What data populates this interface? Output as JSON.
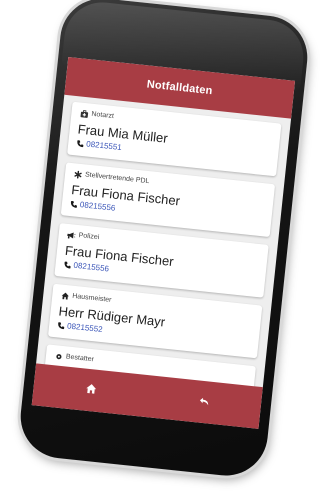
{
  "appbar": {
    "title": "Notfalldaten"
  },
  "contacts": [
    {
      "role": "Notarzt",
      "icon": "medical-case-icon",
      "name": "Frau Mia Müller",
      "phone": "08215551"
    },
    {
      "role": "Stellvertretende PDL",
      "icon": "asterisk-icon",
      "name": "Frau Fiona Fischer",
      "phone": "08215556"
    },
    {
      "role": "Polizei",
      "icon": "megaphone-icon",
      "name": "Frau Fiona Fischer",
      "phone": "08215556"
    },
    {
      "role": "Hausmeister",
      "icon": "house-icon",
      "name": "Herr Rüdiger Mayr",
      "phone": "08215552"
    },
    {
      "role": "Bestatter",
      "icon": "settings-icon",
      "name": "",
      "phone": ""
    }
  ],
  "bottombar": {
    "items": [
      {
        "icon": "home-icon"
      },
      {
        "icon": "back-arrow-icon"
      }
    ]
  },
  "colors": {
    "accent": "#a83d44",
    "phone_link": "#3a55b8",
    "background": "#eeeeee"
  }
}
